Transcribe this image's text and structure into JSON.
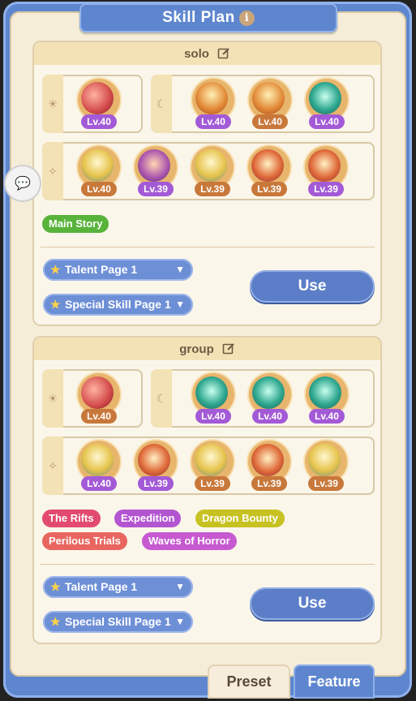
{
  "title": "Skill Plan",
  "colors": {
    "frame": "#5e86cf",
    "panel": "#f6edd9",
    "header": "#f3e2b5"
  },
  "plans": [
    {
      "name": "solo",
      "day_skills": [
        {
          "level": "Lv.40",
          "style": "red",
          "badge": "purple"
        }
      ],
      "night_skills": [
        {
          "level": "Lv.40",
          "style": "orange",
          "badge": "purple"
        },
        {
          "level": "Lv.40",
          "style": "orange",
          "badge": "orange"
        },
        {
          "level": "Lv.40",
          "style": "teal",
          "badge": "purple"
        }
      ],
      "star_skills": [
        {
          "level": "Lv.40",
          "style": "gold",
          "badge": "orange"
        },
        {
          "level": "Lv.39",
          "style": "purple",
          "badge": "purple"
        },
        {
          "level": "Lv.39",
          "style": "gold",
          "badge": "orange"
        },
        {
          "level": "Lv.39",
          "style": "fire",
          "badge": "orange"
        },
        {
          "level": "Lv.39",
          "style": "fire",
          "badge": "purple"
        }
      ],
      "tags": [
        {
          "label": "Main Story",
          "color": "#58b33b"
        }
      ],
      "talent_page": "Talent Page 1",
      "special_page": "Special Skill Page 1",
      "use_label": "Use"
    },
    {
      "name": "group",
      "day_skills": [
        {
          "level": "Lv.40",
          "style": "red",
          "badge": "orange"
        }
      ],
      "night_skills": [
        {
          "level": "Lv.40",
          "style": "teal",
          "badge": "purple"
        },
        {
          "level": "Lv.40",
          "style": "teal",
          "badge": "purple"
        },
        {
          "level": "Lv.40",
          "style": "teal",
          "badge": "purple"
        }
      ],
      "star_skills": [
        {
          "level": "Lv.40",
          "style": "gold",
          "badge": "purple"
        },
        {
          "level": "Lv.39",
          "style": "fire",
          "badge": "purple"
        },
        {
          "level": "Lv.39",
          "style": "gold",
          "badge": "orange"
        },
        {
          "level": "Lv.39",
          "style": "fire",
          "badge": "orange"
        },
        {
          "level": "Lv.39",
          "style": "gold",
          "badge": "orange"
        }
      ],
      "tags": [
        {
          "label": "The Rifts",
          "color": "#e24b6f"
        },
        {
          "label": "Expedition",
          "color": "#b355d1"
        },
        {
          "label": "Dragon Bounty",
          "color": "#c7c222"
        },
        {
          "label": "Perilous Trials",
          "color": "#e8665f"
        },
        {
          "label": "Waves of Horror",
          "color": "#c75ad0"
        }
      ],
      "talent_page": "Talent Page 1",
      "special_page": "Special Skill Page 1",
      "use_label": "Use"
    }
  ],
  "tabs": {
    "preset": "Preset",
    "feature": "Feature"
  },
  "icons": {
    "day": "sun-icon",
    "night": "moon-icon",
    "star": "sparkle-icon",
    "edit": "edit-icon",
    "info": "info-icon",
    "chat": "chat-bubble-icon"
  }
}
